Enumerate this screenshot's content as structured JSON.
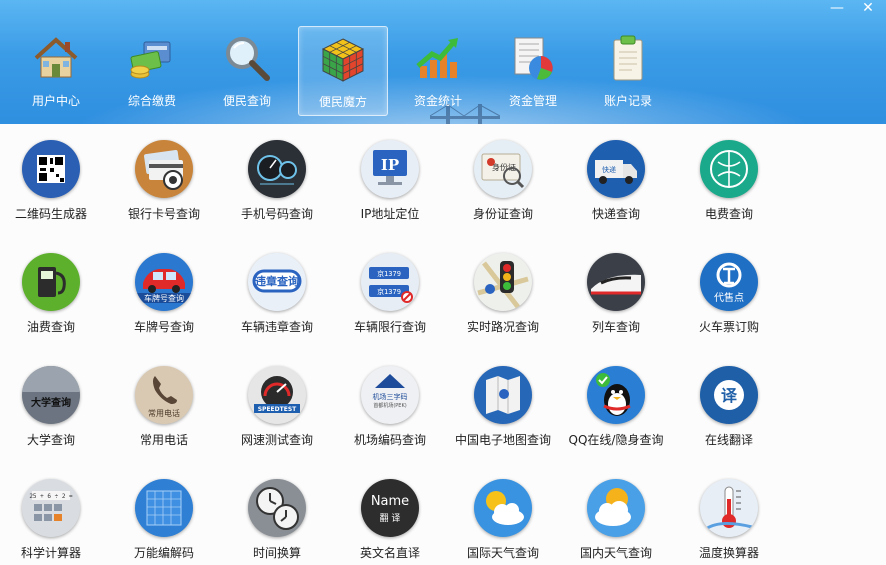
{
  "window": {
    "minimize_symbol": "—",
    "close_symbol": "✕"
  },
  "tabs": [
    {
      "label": "用户中心",
      "icon": "house-icon"
    },
    {
      "label": "综合缴费",
      "icon": "cash-card-icon"
    },
    {
      "label": "便民查询",
      "icon": "magnifier-icon"
    },
    {
      "label": "便民魔方",
      "icon": "rubik-cube-icon",
      "active": true
    },
    {
      "label": "资金统计",
      "icon": "growth-chart-icon"
    },
    {
      "label": "资金管理",
      "icon": "pie-ledger-icon"
    },
    {
      "label": "账户记录",
      "icon": "clipboard-icon"
    }
  ],
  "tools": [
    {
      "label": "二维码生成器",
      "icon": "qr-code-icon",
      "bg": "#2a5fb4"
    },
    {
      "label": "银行卡号查询",
      "icon": "bank-card-icon",
      "bg": "#c8843a"
    },
    {
      "label": "手机号码查询",
      "icon": "phone-gauge-icon",
      "bg": "#2b2f36"
    },
    {
      "label": "IP地址定位",
      "icon": "ip-monitor-icon",
      "bg": "#e8eef6"
    },
    {
      "label": "身份证查询",
      "icon": "id-card-icon",
      "bg": "#e6eef5"
    },
    {
      "label": "快递查询",
      "icon": "delivery-truck-icon",
      "bg": "#1f5fb0"
    },
    {
      "label": "电费查询",
      "icon": "power-grid-icon",
      "bg": "#1aa98a"
    },
    {
      "label": "油费查询",
      "icon": "fuel-pump-icon",
      "bg": "#5db02c"
    },
    {
      "label": "车牌号查询",
      "icon": "red-car-icon",
      "bg": "#2a78d0"
    },
    {
      "label": "车辆违章查询",
      "icon": "violation-sign-icon",
      "bg": "#e9f0f8"
    },
    {
      "label": "车辆限行查询",
      "icon": "plate-limit-icon",
      "bg": "#e7edf4"
    },
    {
      "label": "实时路况查询",
      "icon": "traffic-light-icon",
      "bg": "#eef0ec"
    },
    {
      "label": "列车查询",
      "icon": "bullet-train-icon",
      "bg": "#3a3f48"
    },
    {
      "label": "火车票订购",
      "icon": "railway-ticket-icon",
      "bg": "#1f6fc4"
    },
    {
      "label": "大学查询",
      "icon": "university-icon",
      "bg": "#6b7480"
    },
    {
      "label": "常用电话",
      "icon": "phone-handset-icon",
      "bg": "#d9c9b2"
    },
    {
      "label": "网速测试查询",
      "icon": "speedometer-icon",
      "bg": "#e6e6e6"
    },
    {
      "label": "机场编码查询",
      "icon": "airport-code-icon",
      "bg": "#eef0f3"
    },
    {
      "label": "中国电子地图查询",
      "icon": "map-icon",
      "bg": "#2767b8"
    },
    {
      "label": "QQ在线/隐身查询",
      "icon": "penguin-icon",
      "bg": "#2a7fd5"
    },
    {
      "label": "在线翻译",
      "icon": "translate-icon",
      "bg": "#1e5fa8"
    },
    {
      "label": "科学计算器",
      "icon": "calculator-icon",
      "bg": "#d9dde2"
    },
    {
      "label": "万能编解码",
      "icon": "codec-icon",
      "bg": "#2f7fd4"
    },
    {
      "label": "时间换算",
      "icon": "clocks-icon",
      "bg": "#8a8f96"
    },
    {
      "label": "英文名直译",
      "icon": "name-translate-icon",
      "bg": "#2d2d2d"
    },
    {
      "label": "国际天气查询",
      "icon": "weather-sun-cloud-icon",
      "bg": "#3a93e0"
    },
    {
      "label": "国内天气查询",
      "icon": "weather-sun-cloud2-icon",
      "bg": "#4aa0e6"
    },
    {
      "label": "温度换算器",
      "icon": "thermometer-icon",
      "bg": "#e7eef6"
    }
  ],
  "tile_texts": {
    "ip": "IP",
    "id_card": "身份证",
    "express": "快递",
    "plate_query": "车牌号查询",
    "violation": "违章查询",
    "plate_num1": "京1379",
    "plate_num2": "京1379",
    "ticket_office": "代售点",
    "university": "大学查询",
    "common_phone": "常用电话",
    "speed": "SPEEDTEST",
    "airport_code": "机场三字码",
    "airport_sub": "首都机场(PEK)",
    "translate_char": "译",
    "name_en": "Name",
    "name_cn": "翻 译",
    "calc_expr": "25 + 6 ÷ 2 ="
  }
}
